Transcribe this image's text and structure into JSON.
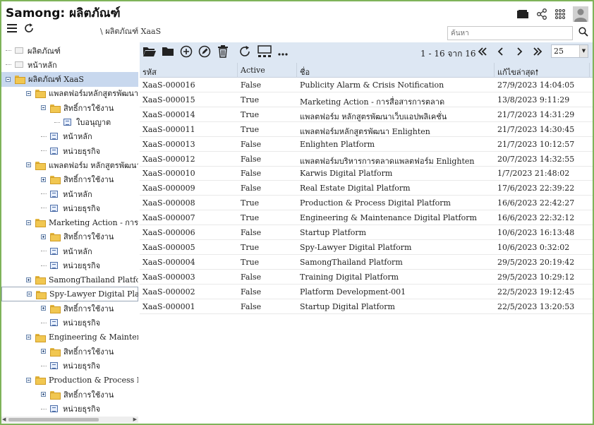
{
  "app": {
    "title": "Samong: ผลิตภัณฑ์",
    "breadcrumb": "\\ ผลิตภัณฑ์ XaaS"
  },
  "header_icons": [
    "folder-icon",
    "share-icon",
    "apps-grid-icon",
    "user-avatar-icon"
  ],
  "search": {
    "placeholder": "ค้นหา"
  },
  "tree": [
    {
      "label": "ผลิตภัณฑ์",
      "indent": 0,
      "icon": "folder-plain",
      "toggle": "none"
    },
    {
      "label": "หน้าหลัก",
      "indent": 0,
      "icon": "folder-plain",
      "toggle": "none"
    },
    {
      "label": "ผลิตภัณฑ์ XaaS",
      "indent": 0,
      "icon": "folder",
      "toggle": "minus",
      "selected": true
    },
    {
      "label": "แพลตฟอร์มหลักสูตรพัฒนา Enlighten",
      "indent": 1,
      "icon": "folder",
      "toggle": "minus"
    },
    {
      "label": "สิทธิ์การใช้งาน",
      "indent": 2,
      "icon": "folder",
      "toggle": "minus"
    },
    {
      "label": "ใบอนุญาต",
      "indent": 3,
      "icon": "page",
      "toggle": "none"
    },
    {
      "label": "หน้าหลัก",
      "indent": 2,
      "icon": "page",
      "toggle": "none"
    },
    {
      "label": "หน่วยธุรกิจ",
      "indent": 2,
      "icon": "page",
      "toggle": "none"
    },
    {
      "label": "แพลตฟอร์ม หลักสูตรพัฒนาเว็บแอปพลิเคชั่น",
      "indent": 1,
      "icon": "folder",
      "toggle": "minus"
    },
    {
      "label": "สิทธิ์การใช้งาน",
      "indent": 2,
      "icon": "folder",
      "toggle": "plus"
    },
    {
      "label": "หน้าหลัก",
      "indent": 2,
      "icon": "page",
      "toggle": "none"
    },
    {
      "label": "หน่วยธุรกิจ",
      "indent": 2,
      "icon": "page",
      "toggle": "none"
    },
    {
      "label": "Marketing Action - การสื่อสารการตลาด",
      "indent": 1,
      "icon": "folder",
      "toggle": "minus"
    },
    {
      "label": "สิทธิ์การใช้งาน",
      "indent": 2,
      "icon": "folder",
      "toggle": "plus"
    },
    {
      "label": "หน้าหลัก",
      "indent": 2,
      "icon": "page",
      "toggle": "none"
    },
    {
      "label": "หน่วยธุรกิจ",
      "indent": 2,
      "icon": "page",
      "toggle": "none"
    },
    {
      "label": "SamongThailand Platform",
      "indent": 1,
      "icon": "folder",
      "toggle": "plus"
    },
    {
      "label": "Spy-Lawyer Digital Platform",
      "indent": 1,
      "icon": "folder",
      "toggle": "minus",
      "focused": true
    },
    {
      "label": "สิทธิ์การใช้งาน",
      "indent": 2,
      "icon": "folder",
      "toggle": "plus"
    },
    {
      "label": "หน่วยธุรกิจ",
      "indent": 2,
      "icon": "page",
      "toggle": "none"
    },
    {
      "label": "Engineering & Maintenance Digital Platform",
      "indent": 1,
      "icon": "folder",
      "toggle": "minus"
    },
    {
      "label": "สิทธิ์การใช้งาน",
      "indent": 2,
      "icon": "folder",
      "toggle": "plus"
    },
    {
      "label": "หน่วยธุรกิจ",
      "indent": 2,
      "icon": "page",
      "toggle": "none"
    },
    {
      "label": "Production & Process Digital Platform",
      "indent": 1,
      "icon": "folder",
      "toggle": "minus"
    },
    {
      "label": "สิทธิ์การใช้งาน",
      "indent": 2,
      "icon": "folder",
      "toggle": "plus"
    },
    {
      "label": "หน่วยธุรกิจ",
      "indent": 2,
      "icon": "page",
      "toggle": "none"
    }
  ],
  "grid_toolbar": [
    "open-folder-icon",
    "folder-icon",
    "add-icon",
    "edit-icon",
    "delete-icon",
    "refresh-icon",
    "layout-icon",
    "more-icon"
  ],
  "pager": {
    "range": "1 - 16 จาก 16",
    "page_size": "25"
  },
  "columns": [
    "รหัส",
    "Active",
    "ชื่อ",
    "แก้ไขล่าสุด"
  ],
  "sort_column": "แก้ไขล่าสุด",
  "rows": [
    [
      "XaaS-000016",
      "False",
      "Publicity Alarm & Crisis Notification",
      "27/9/2023 14:04:05"
    ],
    [
      "XaaS-000015",
      "True",
      "Marketing Action - การสื่อสารการตลาด",
      "13/8/2023 9:11:29"
    ],
    [
      "XaaS-000014",
      "True",
      "แพลตฟอร์ม หลักสูตรพัฒนาเว็บแอปพลิเคชั่น",
      "21/7/2023 14:31:29"
    ],
    [
      "XaaS-000011",
      "True",
      "แพลตฟอร์มหลักสูตรพัฒนา Enlighten",
      "21/7/2023 14:30:45"
    ],
    [
      "XaaS-000013",
      "False",
      "Enlighten Platform",
      "21/7/2023 10:12:57"
    ],
    [
      "XaaS-000012",
      "False",
      "แพลตฟอร์มบริหารการตลาดแพลตฟอร์ม Enlighten",
      "20/7/2023 14:32:55"
    ],
    [
      "XaaS-000010",
      "False",
      "Karwis Digital Platform",
      "1/7/2023 21:48:02"
    ],
    [
      "XaaS-000009",
      "False",
      "Real Estate Digital Platform",
      "17/6/2023 22:39:22"
    ],
    [
      "XaaS-000008",
      "True",
      "Production & Process Digital Platform",
      "16/6/2023 22:42:27"
    ],
    [
      "XaaS-000007",
      "True",
      "Engineering & Maintenance Digital Platform",
      "16/6/2023 22:32:12"
    ],
    [
      "XaaS-000006",
      "False",
      "Startup Platform",
      "10/6/2023 16:13:48"
    ],
    [
      "XaaS-000005",
      "True",
      "Spy-Lawyer Digital Platform",
      "10/6/2023 0:32:02"
    ],
    [
      "XaaS-000004",
      "True",
      "SamongThailand Platform",
      "29/5/2023 20:19:42"
    ],
    [
      "XaaS-000003",
      "False",
      "Training Digital Platform",
      "29/5/2023 10:29:12"
    ],
    [
      "XaaS-000002",
      "False",
      "Platform Development-001",
      "22/5/2023 19:12:45"
    ],
    [
      "XaaS-000001",
      "False",
      "Startup Digital Platform",
      "22/5/2023 13:20:53"
    ]
  ],
  "colors": {
    "frame": "#7fb35a",
    "toolbar_bg": "#dde7f3",
    "selected_bg": "#c8d8ee"
  }
}
